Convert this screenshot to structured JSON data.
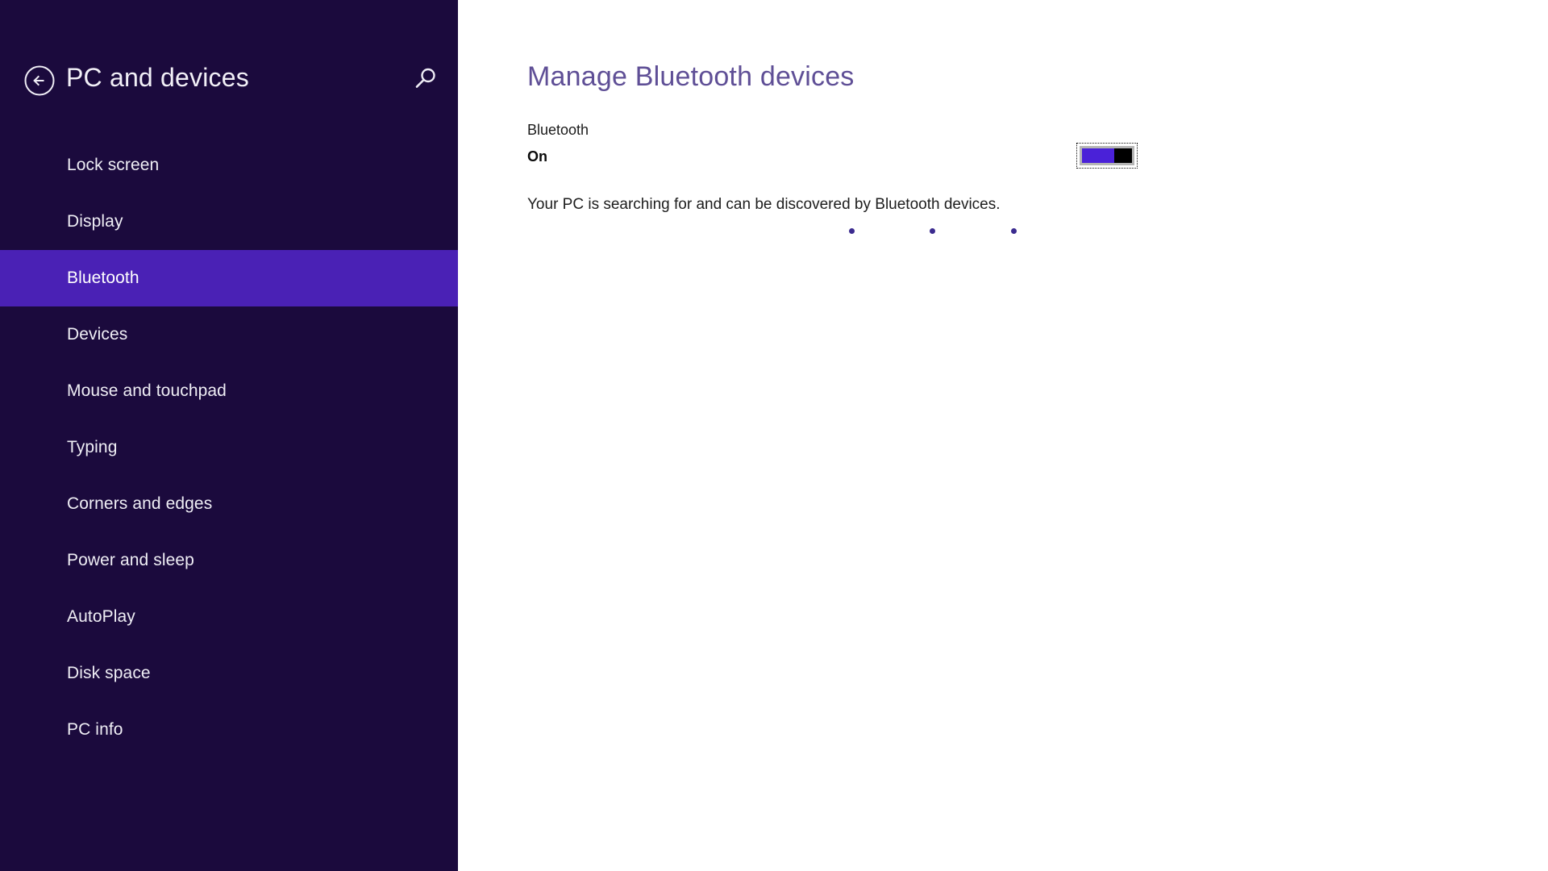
{
  "window": {
    "title": "PC and devices"
  },
  "sidebar": {
    "header": {
      "title": "PC and devices",
      "back_icon": "back-arrow-circle-icon",
      "search_icon": "search-icon"
    },
    "background_color": "#1b0a3d",
    "selected_color": "#4a21b5",
    "selected_index": 2,
    "items": [
      {
        "label": "Lock screen"
      },
      {
        "label": "Display"
      },
      {
        "label": "Bluetooth"
      },
      {
        "label": "Devices"
      },
      {
        "label": "Mouse and touchpad"
      },
      {
        "label": "Typing"
      },
      {
        "label": "Corners and edges"
      },
      {
        "label": "Power and sleep"
      },
      {
        "label": "AutoPlay"
      },
      {
        "label": "Disk space"
      },
      {
        "label": "PC info"
      }
    ]
  },
  "main": {
    "heading": "Manage Bluetooth devices",
    "heading_color": "#5f4f96",
    "bluetooth": {
      "section_label": "Bluetooth",
      "state_label": "On",
      "toggle_on": true,
      "toggle_fill_color": "#4a21d8",
      "toggle_thumb_color": "#000000",
      "toggle_focused": true
    },
    "status_text": "Your PC is searching for and can be discovered by Bluetooth devices.",
    "progress": {
      "dot_color": "#3b2b8f",
      "dot_count": 3
    }
  }
}
